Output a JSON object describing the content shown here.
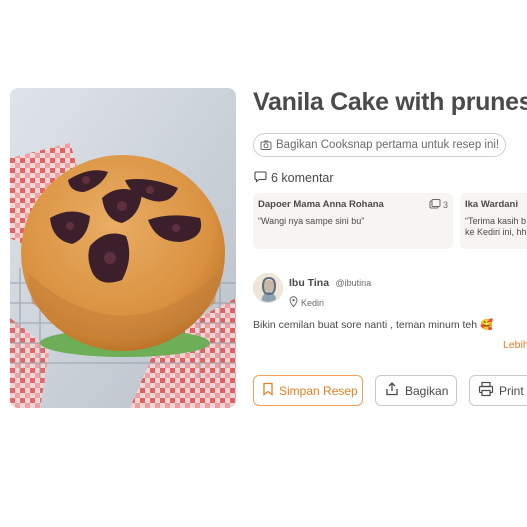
{
  "recipe": {
    "title": "Vanila Cake with prunes",
    "cooksnap_prompt": "Bagikan Cooksnap pertama untuk resep ini!",
    "comments_label": "6 komentar",
    "description": "Bikin cemilan buat sore nanti , teman minum teh 🥰",
    "more_link": "Lebih"
  },
  "comments": [
    {
      "author": "Dapoer Mama Anna Rohana",
      "text": "“Wangi nya sampe sini bu”",
      "snap_count": "3"
    },
    {
      "author": "Ika Wardani",
      "text": "“Terima kasih b ke Kediri ini, hh"
    }
  ],
  "author": {
    "name": "Ibu Tina",
    "handle": "@ibutina",
    "location": "Kediri"
  },
  "actions": {
    "save_label": "Simpan Resep",
    "share_label": "Bagikan",
    "print_label": "Print"
  },
  "colors": {
    "accent": "#e67e22",
    "text": "#4a4a4a",
    "muted": "#6b6b6b",
    "card_bg": "#f7f5f2"
  }
}
